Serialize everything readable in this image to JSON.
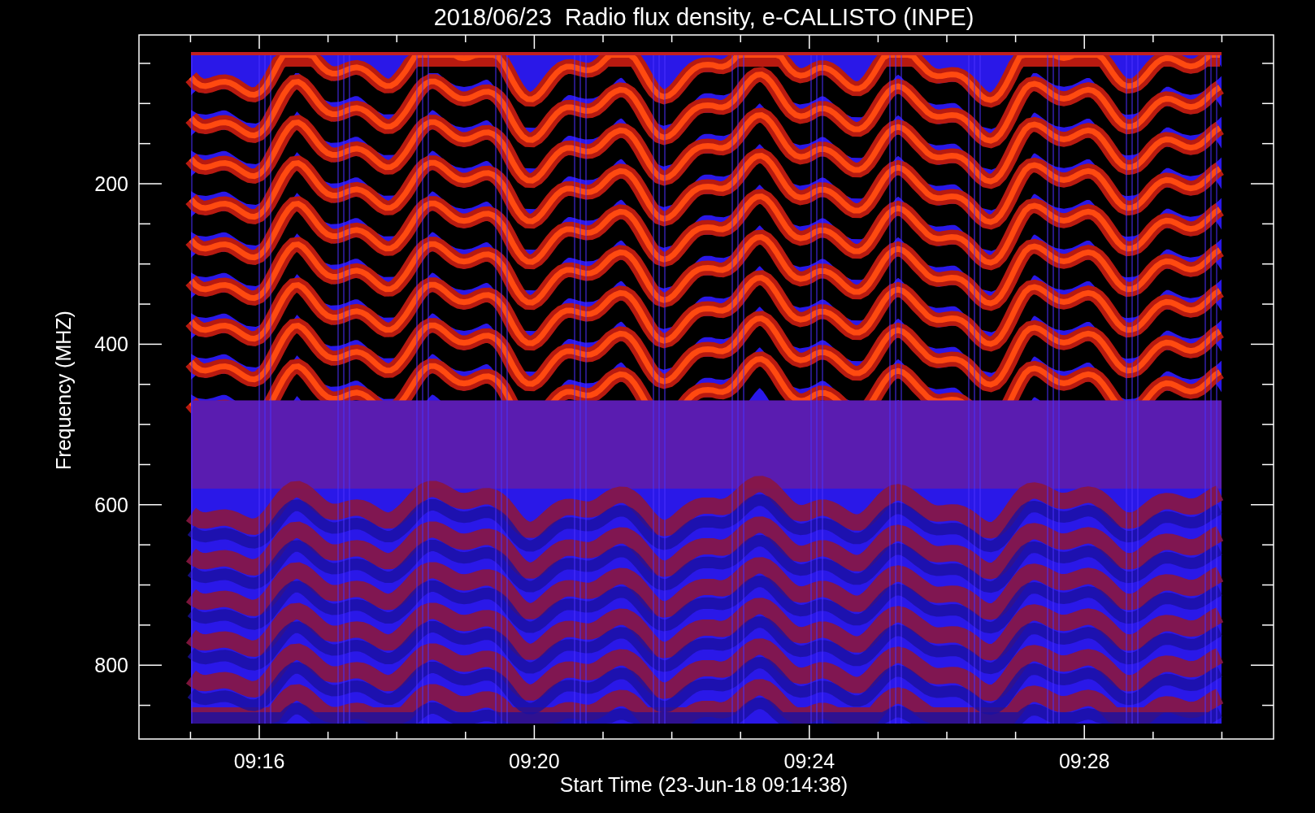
{
  "title": "2018/06/23  Radio flux density, e-CALLISTO (INPE)",
  "x_axis": {
    "label": "Start Time (23-Jun-18 09:14:38)",
    "ticks": [
      "09:16",
      "09:20",
      "09:24",
      "09:28"
    ]
  },
  "y_axis": {
    "label": "Frequency (MHZ)",
    "ticks": [
      "200",
      "400",
      "600",
      "800"
    ]
  }
}
